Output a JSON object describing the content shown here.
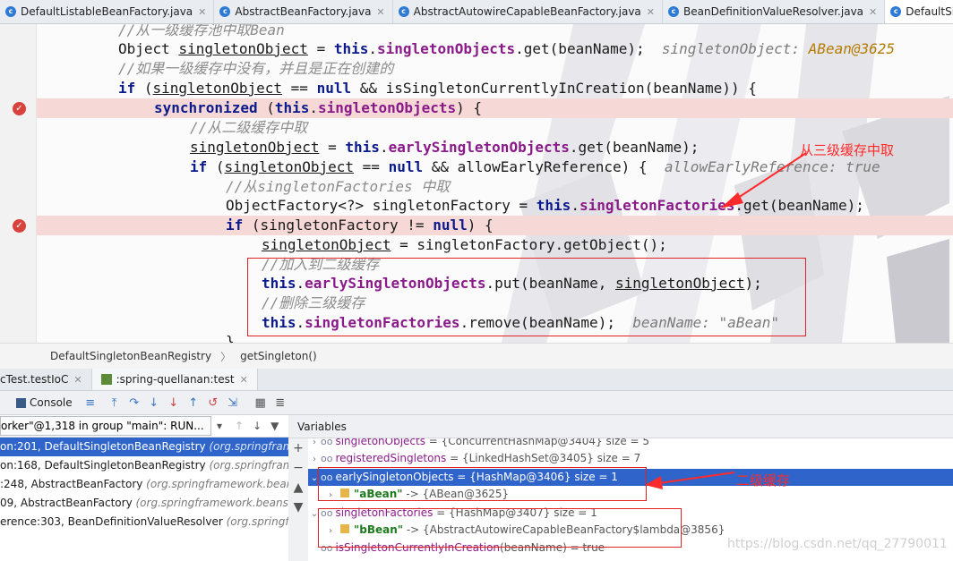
{
  "tabs": [
    {
      "name": "DefaultListableBeanFactory.java"
    },
    {
      "name": "AbstractBeanFactory.java"
    },
    {
      "name": "AbstractAutowireCapableBeanFactory.java"
    },
    {
      "name": "BeanDefinitionValueResolver.java"
    },
    {
      "name": "DefaultSingletonBeanRegistry.java"
    }
  ],
  "code": {
    "c1": "//从一级缓存池中取Bean",
    "l2_a": "Object ",
    "l2_b": "singletonObject",
    "l2_c": " = ",
    "l2_d": "this",
    "l2_e": ".",
    "l2_f": "singletonObjects",
    "l2_g": ".get(beanName);",
    "l2_hint_label": "singletonObject: ",
    "l2_hint_value": "ABean@3625",
    "c3": "//如果一级缓存中没有，并且是正在创建的",
    "l4_a": "if",
    "l4_b": " (",
    "l4_c": "singletonObject",
    "l4_d": " == ",
    "l4_e": "null",
    "l4_f": " && isSingletonCurrentlyInCreation(beanName)) {",
    "l5_a": "synchronized",
    "l5_b": " (",
    "l5_c": "this",
    "l5_d": ".",
    "l5_e": "singletonObjects",
    "l5_f": ") {",
    "c6": "//从二级缓存中取",
    "l7_a": "singletonObject",
    "l7_b": " = ",
    "l7_c": "this",
    "l7_d": ".",
    "l7_e": "earlySingletonObjects",
    "l7_f": ".get(beanName);",
    "l8_a": "if",
    "l8_b": " (",
    "l8_c": "singletonObject",
    "l8_d": " == ",
    "l8_e": "null",
    "l8_f": " && allowEarlyReference) {",
    "l8_hint": "allowEarlyReference: true",
    "c9": "//从singletonFactories 中取",
    "l10_a": "ObjectFactory<?> singletonFactory = ",
    "l10_b": "this",
    "l10_c": ".",
    "l10_d": "singletonFactories",
    "l10_e": ".get(beanName);",
    "l11_a": "if",
    "l11_b": " (singletonFactory != ",
    "l11_c": "null",
    "l11_d": ") {",
    "l12_a": "singletonObject",
    "l12_b": " = singletonFactory.getObject();",
    "c13": "//加入到二级缓存",
    "l14_a": "this",
    "l14_b": ".",
    "l14_c": "earlySingletonObjects",
    "l14_d": ".put(beanName, ",
    "l14_e": "singletonObject",
    "l14_f": ");",
    "c15": "//删除三级缓存",
    "l16_a": "this",
    "l16_b": ".",
    "l16_c": "singletonFactories",
    "l16_d": ".remove(beanName);",
    "l16_hint": "beanName: \"aBean\"",
    "l17": "}"
  },
  "annotations": {
    "from_level3": "从三级缓存中取",
    "level2": "二级缓存"
  },
  "breadcrumb": {
    "class_name": "DefaultSingletonBeanRegistry",
    "sep": "〉",
    "method": "getSingleton()"
  },
  "debug_tabs": [
    {
      "label": "cTest.testIoC"
    },
    {
      "label": ":spring-quellanan:test"
    }
  ],
  "toolbar": {
    "console_label": "Console"
  },
  "thread_selector": "orker\"@1,318 in group \"main\": RUN...",
  "frames": [
    {
      "text": "on:201, DefaultSingletonBeanRegistry ",
      "pkg": "(org.springframew"
    },
    {
      "text": "on:168, DefaultSingletonBeanRegistry ",
      "pkg": "(org.springframew"
    },
    {
      "text": ":248, AbstractBeanFactory ",
      "pkg": "(org.springframework.beans"
    },
    {
      "text": "09, AbstractBeanFactory ",
      "pkg": "(org.springframework.beans.fac"
    },
    {
      "text": "erence:303, BeanDefinitionValueResolver ",
      "pkg": "(org.springfra"
    }
  ],
  "variables": {
    "title": "Variables",
    "rows": [
      {
        "name": "singletonObjects",
        "value": " = {ConcurrentHashMap@3404}  size = 5"
      },
      {
        "name": "registeredSingletons",
        "value": " = {LinkedHashSet@3405}  size = 7"
      },
      {
        "name": "earlySingletonObjects",
        "value": " = {HashMap@3406}  size = 1"
      },
      {
        "key": "\"aBean\"",
        "value": " -> {ABean@3625}"
      },
      {
        "name": "singletonFactories",
        "value": " = {HashMap@3407}  size = 1"
      },
      {
        "key": "\"bBean\"",
        "value": " -> {AbstractAutowireCapableBeanFactory$lambda@3856}"
      },
      {
        "name": "isSingletonCurrentlyInCreation",
        "value": "(beanName) = true"
      }
    ]
  },
  "watermark": "https://blog.csdn.net/qq_27790011"
}
